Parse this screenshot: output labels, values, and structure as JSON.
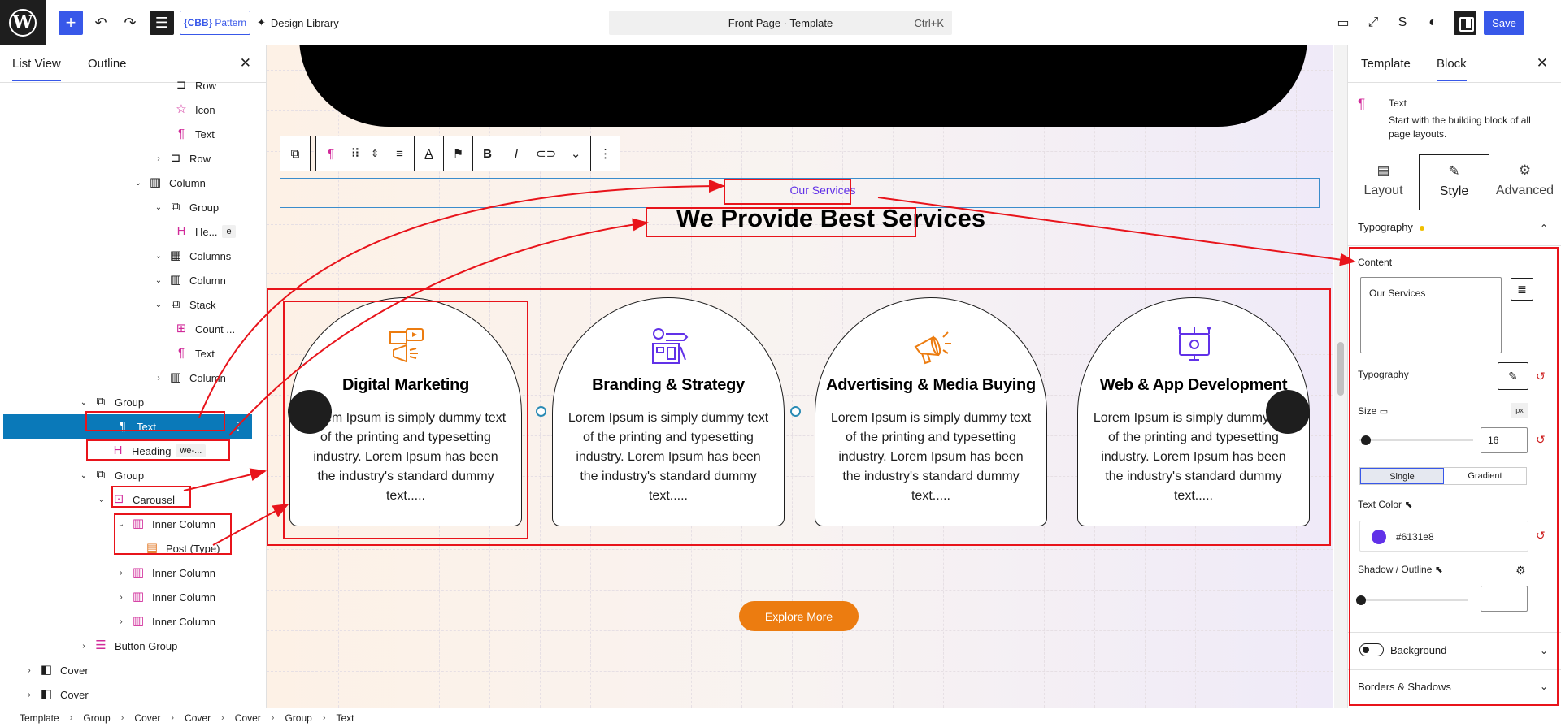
{
  "topbar": {
    "pattern_label": "Pattern",
    "pattern_badge": "{CBB}",
    "design_library": "Design Library",
    "doc_title": "Front Page · Template",
    "shortcut": "Ctrl+K",
    "save": "Save"
  },
  "left_panel": {
    "tab_list_view": "List View",
    "tab_outline": "Outline",
    "tree": [
      {
        "label": "Row",
        "icon": "row-icon"
      },
      {
        "label": "Icon",
        "icon": "star-icon"
      },
      {
        "label": "Text",
        "icon": "paragraph-icon"
      },
      {
        "label": "Row",
        "icon": "row-icon"
      },
      {
        "label": "Column",
        "icon": "column-icon"
      },
      {
        "label": "Group",
        "icon": "group-icon"
      },
      {
        "label": "He...",
        "chip": "e",
        "icon": "heading-icon"
      },
      {
        "label": "Columns",
        "icon": "columns-icon"
      },
      {
        "label": "Column",
        "icon": "column-icon"
      },
      {
        "label": "Stack",
        "icon": "stack-icon"
      },
      {
        "label": "Count ...",
        "icon": "counter-icon"
      },
      {
        "label": "Text",
        "icon": "paragraph-icon"
      },
      {
        "label": "Column",
        "icon": "column-icon"
      },
      {
        "label": "Group",
        "icon": "group-icon"
      },
      {
        "label": "Text",
        "icon": "paragraph-icon"
      },
      {
        "label": "Heading",
        "chip": "we-...",
        "icon": "heading-icon"
      },
      {
        "label": "Group",
        "icon": "group-icon"
      },
      {
        "label": "Carousel",
        "icon": "carousel-icon"
      },
      {
        "label": "Inner Column",
        "icon": "inner-column-icon"
      },
      {
        "label": "Post (Type)",
        "icon": "post-type-icon"
      },
      {
        "label": "Inner Column",
        "icon": "inner-column-icon"
      },
      {
        "label": "Inner Column",
        "icon": "inner-column-icon"
      },
      {
        "label": "Inner Column",
        "icon": "inner-column-icon"
      },
      {
        "label": "Button Group",
        "icon": "button-group-icon"
      },
      {
        "label": "Cover",
        "icon": "cover-icon"
      },
      {
        "label": "Cover",
        "icon": "cover-icon"
      }
    ]
  },
  "canvas": {
    "eyebrow": "Our Services",
    "heading": "We Provide Best Services",
    "cards": [
      {
        "title": "Digital Marketing",
        "desc": "Lorem Ipsum is simply dummy text of the printing and typesetting industry. Lorem Ipsum has been the industry's standard dummy text.....",
        "icon": "megaphone-icon"
      },
      {
        "title": "Branding & Strategy",
        "desc": "Lorem Ipsum is simply dummy text of the printing and typesetting industry. Lorem Ipsum has been the industry's standard dummy text.....",
        "icon": "branding-icon"
      },
      {
        "title": "Advertising & Media Buying",
        "desc": "Lorem Ipsum is simply dummy text of the printing and typesetting industry. Lorem Ipsum has been the industry's standard dummy text.....",
        "icon": "advertising-icon"
      },
      {
        "title": "Web & App Development",
        "desc": "Lorem Ipsum is simply dummy text of the printing and typesetting industry. Lorem Ipsum has been the industry's standard dummy text.....",
        "icon": "web-dev-icon"
      }
    ],
    "button": "Explore More",
    "accent_color": "#6131e8",
    "button_color": "#ec7c10"
  },
  "right_panel": {
    "tab_template": "Template",
    "tab_block": "Block",
    "block_name": "Text",
    "block_desc": "Start with the building block of all page layouts.",
    "style_tabs": [
      "Layout",
      "Style",
      "Advanced"
    ],
    "typography_section": "Typography",
    "content_label": "Content",
    "content_value": "Our Services",
    "typography_label": "Typography",
    "size_label": "Size",
    "size_unit": "px",
    "size_value": "16",
    "fill_single": "Single",
    "fill_gradient": "Gradient",
    "text_color_label": "Text Color",
    "text_color_value": "#6131e8",
    "shadow_label": "Shadow / Outline",
    "background_label": "Background",
    "borders_label": "Borders & Shadows"
  },
  "breadcrumb": [
    "Template",
    "Group",
    "Cover",
    "Cover",
    "Cover",
    "Group",
    "Text"
  ]
}
